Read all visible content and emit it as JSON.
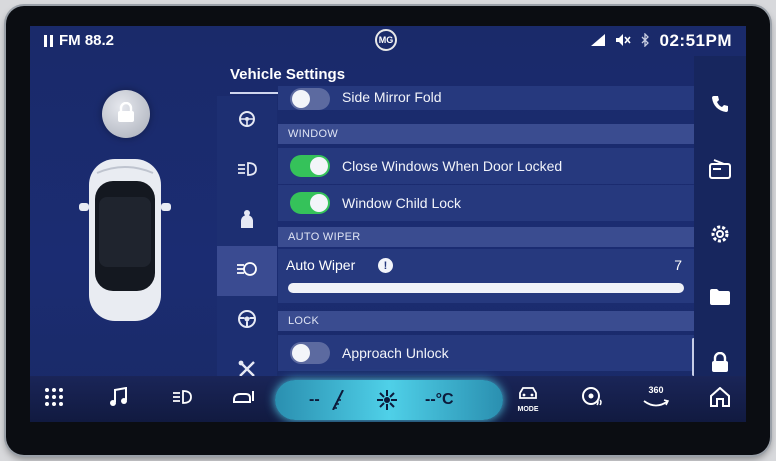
{
  "status": {
    "radio_label": "FM 88.2",
    "brand": "MG",
    "time": "02:51PM"
  },
  "panel": {
    "title": "Vehicle Settings"
  },
  "settings": {
    "side_mirror_fold": {
      "label": "Side Mirror Fold",
      "on": false
    },
    "window_header": "WINDOW",
    "close_windows": {
      "label": "Close Windows When Door Locked",
      "on": true
    },
    "child_lock": {
      "label": "Window Child Lock",
      "on": true
    },
    "auto_wiper_header": "AUTO WIPER",
    "auto_wiper": {
      "label": "Auto Wiper",
      "value": "7",
      "level": 1.0
    },
    "lock_header": "LOCK",
    "approach_unlock": {
      "label": "Approach Unlock",
      "on": false
    }
  },
  "climate": {
    "left_temp": "--",
    "right_temp": "--°C"
  },
  "dock": {
    "mode_label": "MODE",
    "view_label": "360"
  },
  "colors": {
    "toggle_on": "#35c25a",
    "accent_climate": "#4fd0e8",
    "background": "#1b2c72"
  },
  "icons": {
    "category_rail": [
      "steering-wheel-assist-icon",
      "headlight-icon",
      "seat-icon",
      "car-settings-icon",
      "steering-wheel-icon",
      "tools-icon"
    ],
    "right_rail": [
      "phone-icon",
      "radio-icon",
      "gear-icon",
      "folder-icon",
      "lock-icon"
    ],
    "dock": [
      "apps-grid-icon",
      "music-icon",
      "headlight-icon",
      "seat-heat-icon",
      "fan-icon",
      "car-mode-icon",
      "steering-heat-icon",
      "camera-360-icon",
      "home-icon"
    ]
  }
}
